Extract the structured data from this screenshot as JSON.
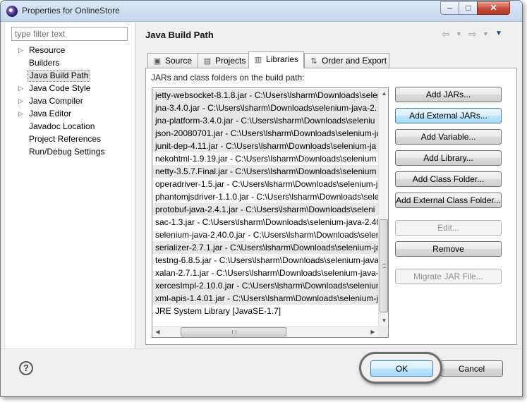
{
  "window": {
    "title": "Properties for OnlineStore",
    "controls": {
      "minimize": "–",
      "maximize": "□",
      "close": "✕"
    }
  },
  "sidebar": {
    "filter_placeholder": "type filter text",
    "items": [
      {
        "label": "Resource",
        "expandable": true
      },
      {
        "label": "Builders",
        "expandable": false
      },
      {
        "label": "Java Build Path",
        "expandable": false,
        "selected": true
      },
      {
        "label": "Java Code Style",
        "expandable": true
      },
      {
        "label": "Java Compiler",
        "expandable": true
      },
      {
        "label": "Java Editor",
        "expandable": true
      },
      {
        "label": "Javadoc Location",
        "expandable": false
      },
      {
        "label": "Project References",
        "expandable": false
      },
      {
        "label": "Run/Debug Settings",
        "expandable": false
      }
    ]
  },
  "page": {
    "title": "Java Build Path",
    "nav_icons": [
      "back-arrow-icon",
      "back-dropdown-icon",
      "forward-arrow-icon",
      "forward-dropdown-icon",
      "view-menu-icon"
    ]
  },
  "tabs": [
    {
      "label": "Source",
      "icon": "source-folder-icon"
    },
    {
      "label": "Projects",
      "icon": "projects-folder-icon"
    },
    {
      "label": "Libraries",
      "icon": "libraries-icon",
      "active": true
    },
    {
      "label": "Order and Export",
      "icon": "order-export-icon"
    }
  ],
  "libraries": {
    "heading": "JARs and class folders on the build path:",
    "items": [
      {
        "text": "jetty-websocket-8.1.8.jar - C:\\Users\\lsharm\\Downloads\\selen",
        "selected": true
      },
      {
        "text": "jna-3.4.0.jar - C:\\Users\\lsharm\\Downloads\\selenium-java-2.",
        "selected": true
      },
      {
        "text": "jna-platform-3.4.0.jar - C:\\Users\\lsharm\\Downloads\\seleniu",
        "selected": true
      },
      {
        "text": "json-20080701.jar - C:\\Users\\lsharm\\Downloads\\selenium-ja",
        "selected": true
      },
      {
        "text": "junit-dep-4.11.jar - C:\\Users\\lsharm\\Downloads\\selenium-ja",
        "selected": true
      },
      {
        "text": "nekohtml-1.9.19.jar - C:\\Users\\lsharm\\Downloads\\selenium",
        "selected": false
      },
      {
        "text": "netty-3.5.7.Final.jar - C:\\Users\\lsharm\\Downloads\\selenium",
        "selected": true
      },
      {
        "text": "operadriver-1.5.jar - C:\\Users\\lsharm\\Downloads\\selenium-j",
        "selected": false
      },
      {
        "text": "phantomjsdriver-1.1.0.jar - C:\\Users\\lsharm\\Downloads\\sele",
        "selected": false
      },
      {
        "text": "protobuf-java-2.4.1.jar - C:\\Users\\lsharm\\Downloads\\seleni",
        "selected": true
      },
      {
        "text": "sac-1.3.jar - C:\\Users\\lsharm\\Downloads\\selenium-java-2.40",
        "selected": false
      },
      {
        "text": "selenium-java-2.40.0.jar - C:\\Users\\lsharm\\Downloads\\seleni",
        "selected": false
      },
      {
        "text": "serializer-2.7.1.jar - C:\\Users\\lsharm\\Downloads\\selenium-ja",
        "selected": true
      },
      {
        "text": "testng-6.8.5.jar - C:\\Users\\lsharm\\Downloads\\selenium-java-",
        "selected": false
      },
      {
        "text": "xalan-2.7.1.jar - C:\\Users\\lsharm\\Downloads\\selenium-java-",
        "selected": false
      },
      {
        "text": "xercesImpl-2.10.0.jar - C:\\Users\\lsharm\\Downloads\\selenium",
        "selected": true
      },
      {
        "text": "xml-apis-1.4.01.jar - C:\\Users\\lsharm\\Downloads\\selenium-ja",
        "selected": true
      },
      {
        "text": "JRE System Library [JavaSE-1.7]",
        "selected": false
      }
    ]
  },
  "buttons": [
    {
      "label": "Add JARs...",
      "state": "normal"
    },
    {
      "label": "Add External JARs...",
      "state": "focused"
    },
    {
      "label": "Add Variable...",
      "state": "normal"
    },
    {
      "label": "Add Library...",
      "state": "normal"
    },
    {
      "label": "Add Class Folder...",
      "state": "normal"
    },
    {
      "label": "Add External Class Folder...",
      "state": "normal"
    },
    {
      "label": "Edit...",
      "state": "disabled"
    },
    {
      "label": "Remove",
      "state": "normal"
    },
    {
      "label": "Migrate JAR File...",
      "state": "disabled"
    }
  ],
  "footer": {
    "help": "?",
    "ok": "OK",
    "cancel": "Cancel"
  },
  "colors": {
    "title_bar": "#c4d7ee",
    "selection": "#e8e8e8",
    "focus_button": "#bee6fd",
    "close_button": "#c54a37",
    "highlight_ring": "#6e6e6e"
  }
}
